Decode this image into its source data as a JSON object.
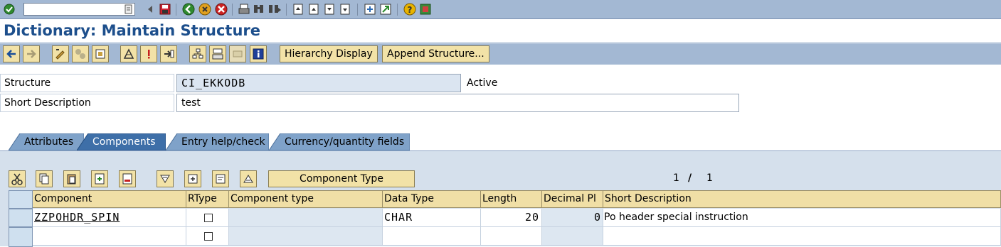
{
  "systoolbar": {
    "command_field": "",
    "icons": [
      "enter-icon",
      "command-dropdown-icon",
      "back-arrow-icon",
      "save-icon",
      "back-icon",
      "exit-icon",
      "cancel-icon",
      "print-icon",
      "find-icon",
      "find-next-icon",
      "first-page-icon",
      "previous-page-icon",
      "next-page-icon",
      "last-page-icon",
      "create-session-icon",
      "shortcut-icon",
      "help-icon",
      "layout-menu-icon"
    ]
  },
  "title": "Dictionary: Maintain Structure",
  "apptoolbar": {
    "icons": [
      "back-nav-icon",
      "forward-nav-icon",
      "display-change-icon",
      "active-inactive-icon",
      "other-object-icon",
      "check-icon",
      "activate-icon",
      "where-used-icon",
      "object-list-icon",
      "navigation-window-icon",
      "print-icon",
      "information-icon"
    ],
    "hierarchy_label": "Hierarchy Display",
    "append_label": "Append Structure..."
  },
  "form": {
    "structure_label": "Structure",
    "structure_value": "CI_EKKODB",
    "status": "Active",
    "shortdesc_label": "Short Description",
    "shortdesc_value": "test"
  },
  "tabs": [
    {
      "label": "Attributes",
      "active": false
    },
    {
      "label": "Components",
      "active": true
    },
    {
      "label": "Entry help/check",
      "active": false
    },
    {
      "label": "Currency/quantity fields",
      "active": false
    }
  ],
  "table_toolbar": {
    "icons": [
      "cut-icon",
      "copy-icon",
      "paste-icon",
      "insert-row-icon",
      "delete-row-icon",
      "sort-icon",
      "select-block-icon",
      "move-icon",
      "up-icon"
    ],
    "component_type_label": "Component Type",
    "page_current": "1",
    "page_separator": "/",
    "page_total": "1"
  },
  "table": {
    "headers": [
      "Component",
      "RType",
      "Component type",
      "Data Type",
      "Length",
      "Decimal Pl",
      "Short Description"
    ],
    "rows": [
      {
        "component": "ZZPOHDR_SPIN",
        "rtype": false,
        "component_type": "",
        "data_type": "CHAR",
        "length": "20",
        "decimals": "0",
        "short_description": "Po header special instruction"
      },
      {
        "component": "",
        "rtype": false,
        "component_type": "",
        "data_type": "",
        "length": "",
        "decimals": "",
        "short_description": ""
      }
    ]
  },
  "colors": {
    "toolbar_bg": "#a3b8d3",
    "title": "#1d4f8c",
    "button_bg": "#f2e2a7",
    "header_bg": "#f0dfa6",
    "panel_bg": "#d5e0ec",
    "active_tab": "#3e6fa8"
  }
}
